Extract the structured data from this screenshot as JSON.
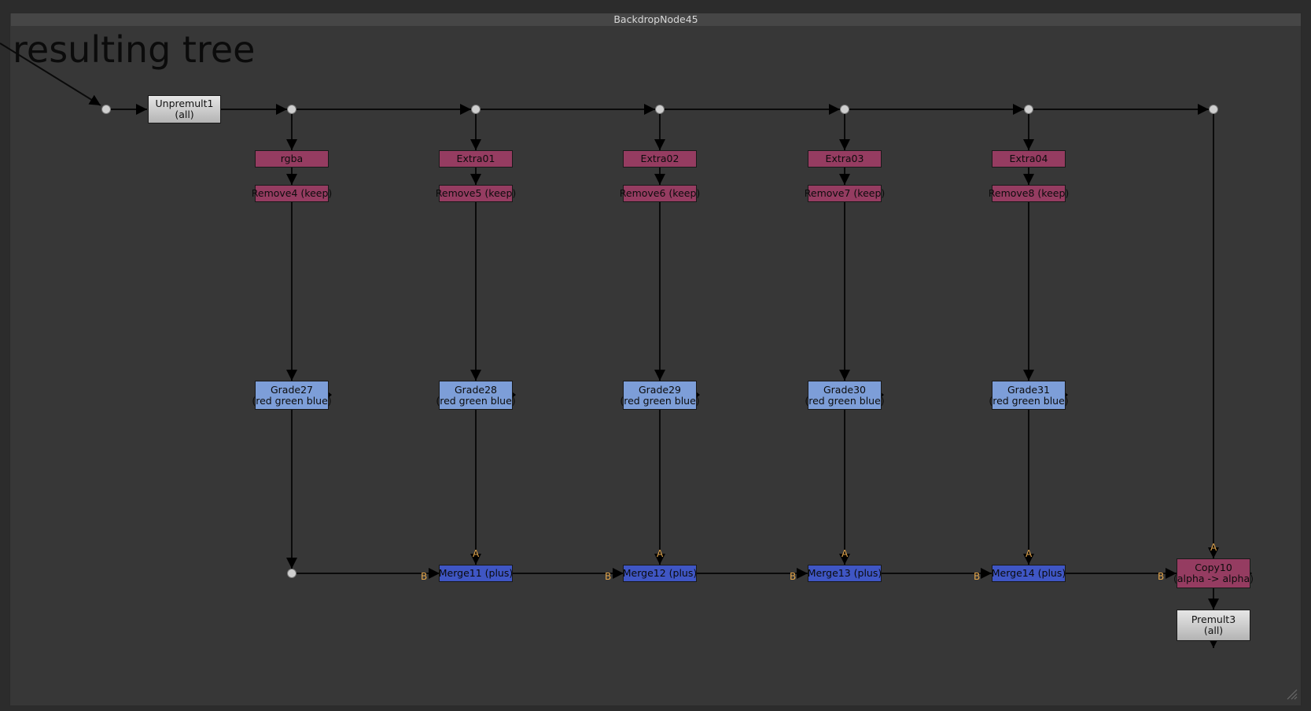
{
  "backdrop": {
    "title": "BackdropNode45"
  },
  "note": {
    "text": "resulting tree"
  },
  "top_node": {
    "line1": "Unpremult1",
    "line2": "(all)"
  },
  "shuffle_nodes": [
    "rgba",
    "Extra01",
    "Extra02",
    "Extra03",
    "Extra04"
  ],
  "remove_nodes": [
    "Remove4 (keep)",
    "Remove5 (keep)",
    "Remove6 (keep)",
    "Remove7 (keep)",
    "Remove8 (keep)"
  ],
  "grade_nodes": [
    {
      "line1": "Grade27",
      "line2": "(red green blue)"
    },
    {
      "line1": "Grade28",
      "line2": "(red green blue)"
    },
    {
      "line1": "Grade29",
      "line2": "(red green blue)"
    },
    {
      "line1": "Grade30",
      "line2": "(red green blue)"
    },
    {
      "line1": "Grade31",
      "line2": "(red green blue)"
    }
  ],
  "merge_nodes": [
    "Merge11 (plus)",
    "Merge12 (plus)",
    "Merge13 (plus)",
    "Merge14 (plus)"
  ],
  "copy_node": {
    "line1": "Copy10",
    "line2": "(alpha -> alpha)"
  },
  "premult_node": {
    "line1": "Premult3",
    "line2": "(all)"
  },
  "pipe_labels": {
    "a": "A",
    "b": "B"
  },
  "colors": {
    "background": "#2c2c2c",
    "backdrop": "#373737",
    "node_gray": "#d0d0d0",
    "node_pink": "#953c61",
    "node_light_blue": "#7d9ed8",
    "node_dark_blue": "#3f56c4",
    "pipe_label": "#e0a44c"
  }
}
